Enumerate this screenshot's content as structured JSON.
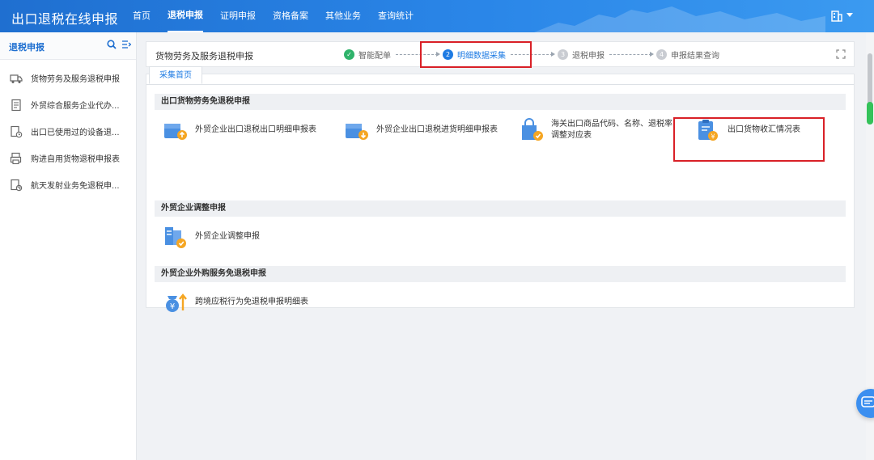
{
  "header": {
    "app_title": "出口退税在线申报",
    "nav": [
      "首页",
      "退税申报",
      "证明申报",
      "资格备案",
      "其他业务",
      "查询统计"
    ],
    "active_nav": "退税申报",
    "user_icon": "building-icon"
  },
  "sidebar": {
    "title": "退税申报",
    "items": [
      {
        "label": "货物劳务及服务退税申报",
        "icon": "truck-icon"
      },
      {
        "label": "外贸综合服务企业代办...",
        "icon": "document-icon"
      },
      {
        "label": "出口已使用过的设备退...",
        "icon": "document-clock-icon"
      },
      {
        "label": "购进自用货物退税申报表",
        "icon": "printer-icon"
      },
      {
        "label": "航天发射业务免退税申...",
        "icon": "document-refresh-icon"
      }
    ]
  },
  "stepbar": {
    "title": "货物劳务及服务退税申报",
    "steps": [
      {
        "num": "1",
        "label": "智能配单",
        "state": "done"
      },
      {
        "num": "2",
        "label": "明细数据采集",
        "state": "current"
      },
      {
        "num": "3",
        "label": "退税申报",
        "state": "pending"
      },
      {
        "num": "4",
        "label": "申报结果查询",
        "state": "pending"
      }
    ]
  },
  "tabs": [
    "采集首页"
  ],
  "sections": [
    {
      "title": "出口货物劳务免退税申报",
      "cards": [
        {
          "label": "外贸企业出口退税出口明细申报表",
          "icon": "upload-box-icon"
        },
        {
          "label": "外贸企业出口退税进货明细申报表",
          "icon": "download-box-icon"
        },
        {
          "label": "海关出口商品代码、名称、退税率",
          "label2": "调整对应表",
          "icon": "shopping-bag-icon"
        },
        {
          "label": "出口货物收汇情况表",
          "icon": "clipboard-money-icon"
        }
      ]
    },
    {
      "title": "外贸企业调整申报",
      "cards": [
        {
          "label": "外贸企业调整申报",
          "icon": "adjust-doc-icon"
        }
      ]
    },
    {
      "title": "外贸企业外购服务免退税申报",
      "cards": [
        {
          "label": "跨境应税行为免退税申报明细表",
          "icon": "money-bag-up-icon"
        }
      ]
    }
  ],
  "colors": {
    "accent": "#1e7be3",
    "highlight": "#d92027",
    "done": "#2fb36b"
  }
}
